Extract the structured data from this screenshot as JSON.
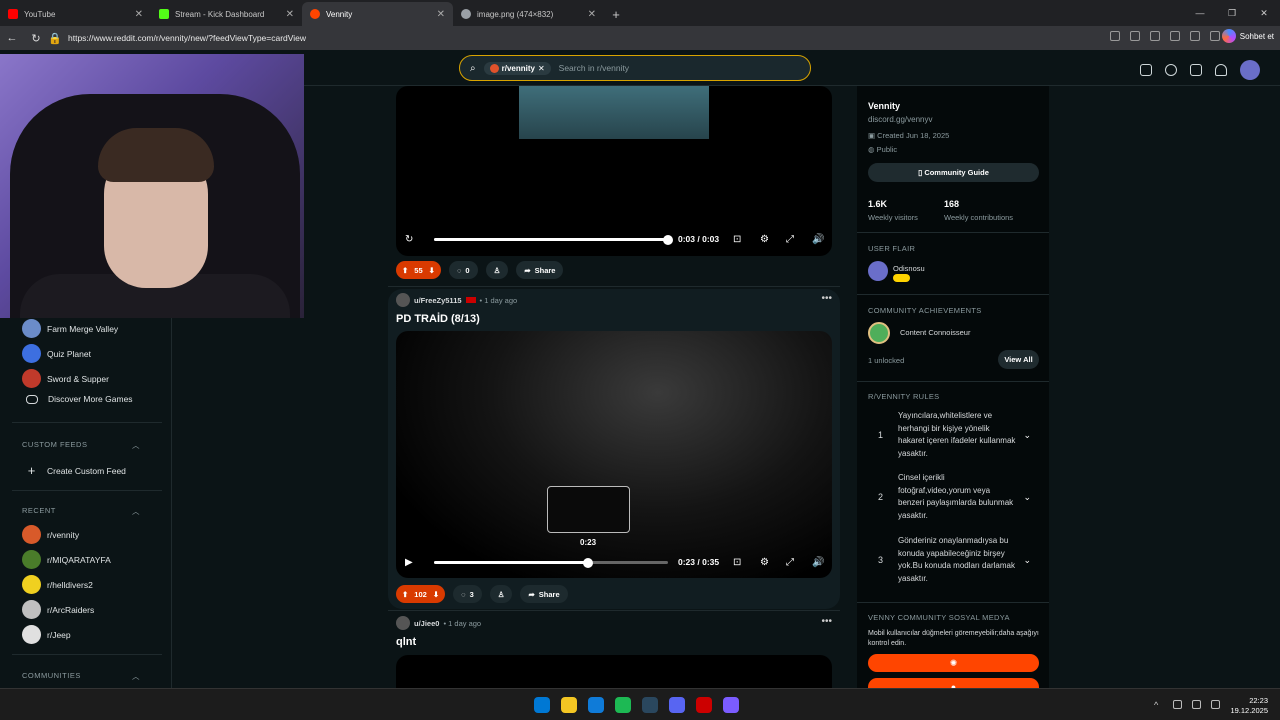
{
  "browser": {
    "tabs": [
      {
        "label": "YouTube",
        "color": "#ff0000"
      },
      {
        "label": "Stream - Kick Dashboard",
        "color": "#53fc18"
      },
      {
        "label": "Vennity",
        "color": "#ff4500"
      },
      {
        "label": "image.png (474×832)",
        "color": "#9aa0a6"
      }
    ],
    "url": "https://www.reddit.com/r/vennity/new/?feedViewType=cardView",
    "copilot_label": "Sohbet et"
  },
  "header": {
    "search_chip": "r/vennity",
    "search_placeholder": "Search in r/vennity"
  },
  "leftnav": {
    "games": [
      {
        "label": "Farm Merge Valley",
        "color": "#6b8cc9"
      },
      {
        "label": "Quiz Planet",
        "color": "#3d6fe0"
      },
      {
        "label": "Sword & Supper",
        "color": "#c03a2b"
      },
      {
        "label": "Discover More Games",
        "color": "#0b1416"
      }
    ],
    "custom_feeds_title": "CUSTOM FEEDS",
    "create_feed": "Create Custom Feed",
    "recent_title": "RECENT",
    "recent": [
      {
        "label": "r/vennity",
        "color": "#d85a2a"
      },
      {
        "label": "r/MIQARATAYFA",
        "color": "#4a7c2a"
      },
      {
        "label": "r/helldivers2",
        "color": "#f0d020"
      },
      {
        "label": "r/ArcRaiders",
        "color": "#c0c0c0"
      },
      {
        "label": "r/Jeep",
        "color": "#e0e0e0"
      }
    ],
    "communities_title": "COMMUNITIES"
  },
  "feed": {
    "post1": {
      "time": "0:03 / 0:03",
      "progress": 1.0,
      "upvotes": "55",
      "comments": "0",
      "share": "Share"
    },
    "post2": {
      "author": "u/FreeZy5115",
      "age": "• 1 day ago",
      "title": "PD TRAİD (8/13)",
      "preview_time": "0:23",
      "time": "0:23 / 0:35",
      "progress": 0.657,
      "upvotes": "102",
      "comments": "3",
      "share": "Share"
    },
    "post3": {
      "author": "u/Jiee0",
      "age": "• 1 day ago",
      "title": "qlnt"
    }
  },
  "sidebar": {
    "name": "Vennity",
    "link": "discord.gg/vennyv",
    "created": "Created Jun 18, 2025",
    "visibility": "Public",
    "guide": "Community Guide",
    "visitors_value": "1.6K",
    "visitors_label": "Weekly visitors",
    "contrib_value": "168",
    "contrib_label": "Weekly contributions",
    "flair_title": "USER FLAIR",
    "flair_user": "Odisnosu",
    "achievements_title": "COMMUNITY ACHIEVEMENTS",
    "achievement": "Content Connoisseur",
    "unlocked": "1 unlocked",
    "view_all": "View All",
    "rules_title": "R/VENNITY RULES",
    "rules": [
      {
        "n": "1",
        "text": "Yayıncılara,whitelistlere ve herhangi bir kişiye yönelik hakaret içeren ifadeler kullanmak yasaktır."
      },
      {
        "n": "2",
        "text": "Cinsel içerikli fotoğraf,video,yorum veya benzeri paylaşımlarda bulunmak yasaktır."
      },
      {
        "n": "3",
        "text": "Gönderiniz onaylanmadıysa bu konuda yapabileceğiniz birşey yok.Bu konuda modları darlamak yasaktır."
      }
    ],
    "social_title": "VENNY COMMUNITY SOSYAL MEDYA",
    "social_desc": "Mobil kullanıcılar düğmeleri göremeyebilir;daha aşağıyı kontrol edin."
  },
  "taskbar": {
    "apps": [
      "#0078d4",
      "#f3c623",
      "#0f7bd8",
      "#1db954",
      "#2a475e",
      "#5865f2",
      "#c00",
      "#7b5cff"
    ],
    "time": "22:23",
    "date": "19.12.2025"
  }
}
